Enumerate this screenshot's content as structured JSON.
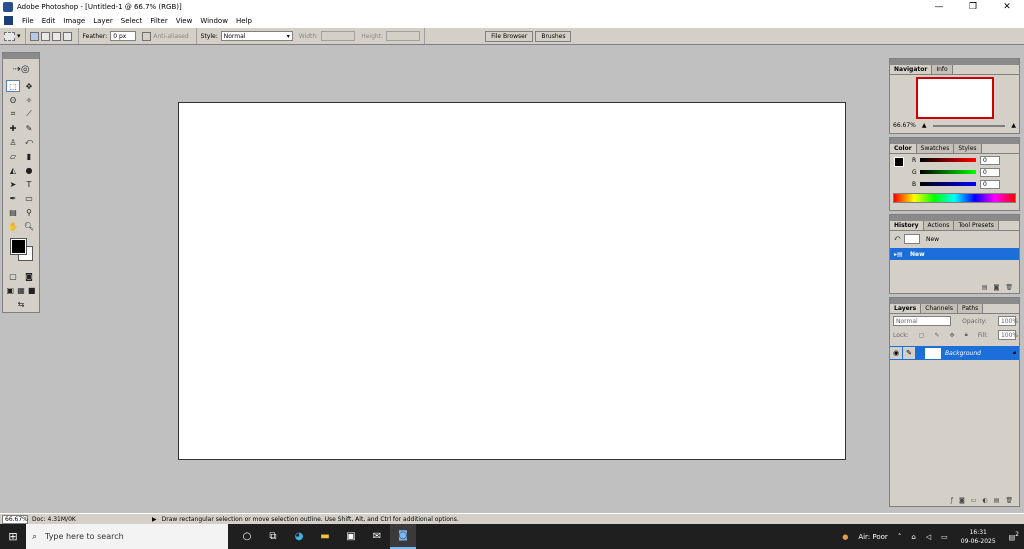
{
  "window": {
    "title": "Adobe Photoshop - [Untitled-1 @ 66.7% (RGB)]",
    "minimize": "—",
    "restore": "❐",
    "close": "✕"
  },
  "menu": [
    "File",
    "Edit",
    "Image",
    "Layer",
    "Select",
    "Filter",
    "View",
    "Window",
    "Help"
  ],
  "options": {
    "feather_label": "Feather:",
    "feather_value": "0 px",
    "antialiased_label": "Anti-aliased",
    "style_label": "Style:",
    "style_value": "Normal",
    "width_label": "Width:",
    "height_label": "Height:",
    "tabs": [
      "File Browser",
      "Brushes"
    ]
  },
  "navigator": {
    "tabs": [
      "Navigator",
      "Info"
    ],
    "zoom": "66.67%"
  },
  "color": {
    "tabs": [
      "Color",
      "Swatches",
      "Styles"
    ],
    "r_label": "R",
    "g_label": "G",
    "b_label": "B",
    "r": "0",
    "g": "0",
    "b": "0"
  },
  "history": {
    "tabs": [
      "History",
      "Actions",
      "Tool Presets"
    ],
    "snapshot_label": "New",
    "state_label": "New"
  },
  "layers": {
    "tabs": [
      "Layers",
      "Channels",
      "Paths"
    ],
    "blend_mode": "Normal",
    "opacity_label": "Opacity:",
    "opacity": "100%",
    "lock_label": "Lock:",
    "fill_label": "Fill:",
    "fill": "100%",
    "layer_name": "Background"
  },
  "status": {
    "zoom": "66.67%",
    "doc": "Doc: 4.31M/0K",
    "hint": "Draw rectangular selection or move selection outline.  Use Shift, Alt, and Ctrl for additional options."
  },
  "taskbar": {
    "search_placeholder": "Type here to search",
    "air": "Air: Poor",
    "time": "16:31",
    "date": "09-06-2025",
    "notifications": "2"
  }
}
